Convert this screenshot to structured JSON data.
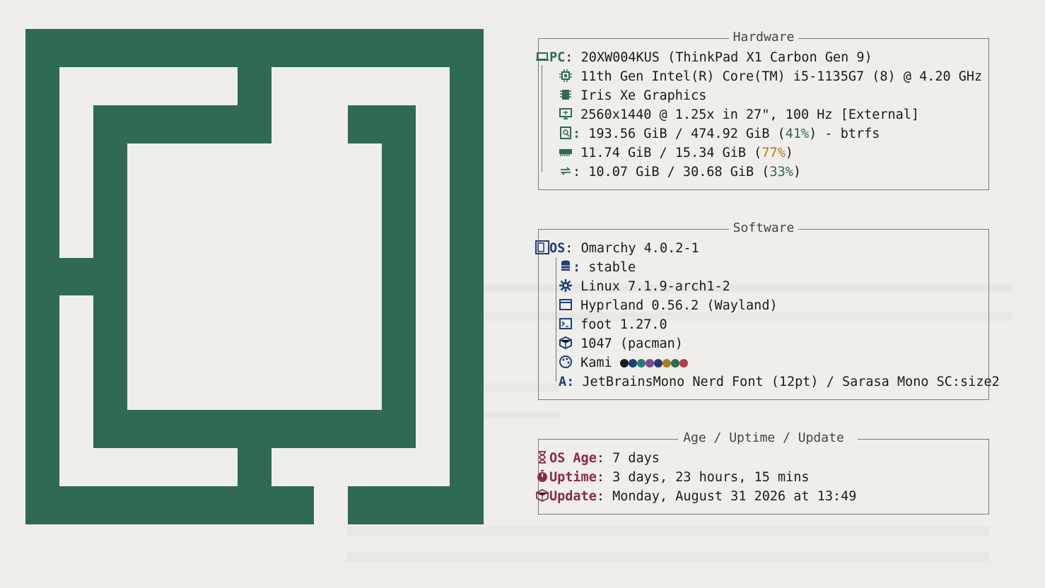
{
  "colors": {
    "accent_green": "#2e6b50",
    "accent_blue": "#1e3f78",
    "accent_red": "#8b2a4a",
    "percent_green": "#2e6b50",
    "percent_amber": "#b0791a",
    "theme_dots": [
      "#1b1b1b",
      "#1e3f78",
      "#2e7a6f",
      "#7c4a8a",
      "#243a6a",
      "#b0791a",
      "#2e6b50",
      "#b83a4a"
    ]
  },
  "hardware": {
    "title": "Hardware",
    "pc_key": "PC",
    "pc_value": "20XW004KUS (ThinkPad X1 Carbon Gen 9)",
    "cpu_value": "11th Gen Intel(R) Core(TM) i5-1135G7 (8) @ 4.20 GHz",
    "gpu_value": "Iris Xe Graphics",
    "display_value": "2560x1440 @ 1.25x in 27\", 100 Hz [External]",
    "disk_value_pre": "193.56 GiB / 474.92 GiB (",
    "disk_pct": "41%",
    "disk_value_post": ") - btrfs",
    "mem_value_pre": "11.74 GiB / 15.34 GiB (",
    "mem_pct": "77%",
    "mem_value_post": ")",
    "swap_value_pre": ": 10.07 GiB / 30.68 GiB (",
    "swap_pct": "33%",
    "swap_value_post": ")"
  },
  "software": {
    "title": "Software",
    "os_key": "OS",
    "os_value": "Omarchy 4.0.2-1",
    "channel_value": "stable",
    "kernel_value": "Linux 7.1.9-arch1-2",
    "wm_value": "Hyprland 0.56.2 (Wayland)",
    "terminal_value": "foot 1.27.0",
    "packages_value": "1047 (pacman)",
    "theme_value": "Kami",
    "font_value": "JetBrainsMono Nerd Font (12pt) / Sarasa Mono SC:size2"
  },
  "age": {
    "title": "Age / Uptime / Update",
    "os_age_key": "OS Age",
    "os_age_value": "7 days",
    "uptime_key": "Uptime",
    "uptime_value": "3 days, 23 hours, 15 mins",
    "update_key": "Update",
    "update_value": "Monday, August 31 2026 at 13:49"
  }
}
